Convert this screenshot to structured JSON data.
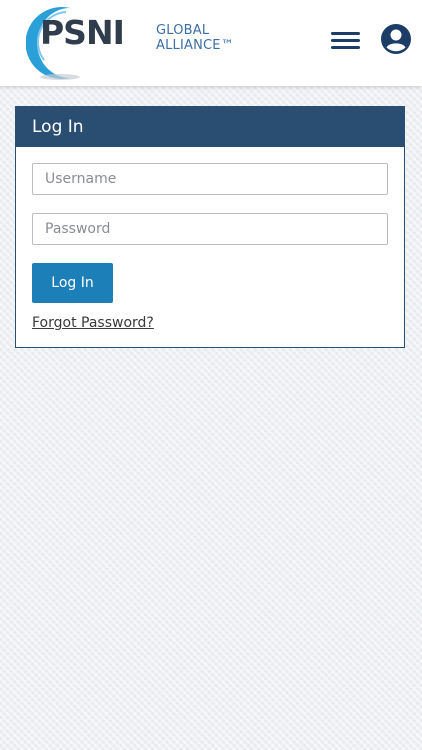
{
  "header": {
    "logo": {
      "brand": "PSNI",
      "line1": "GLOBAL",
      "line2": "ALLIANCE™"
    },
    "menu_icon": "hamburger-menu-icon",
    "user_icon": "user-account-icon"
  },
  "login": {
    "title": "Log In",
    "username_placeholder": "Username",
    "password_placeholder": "Password",
    "submit_label": "Log In",
    "forgot_label": "Forgot Password?"
  },
  "colors": {
    "header_bg": "#ffffff",
    "card_header_bg": "#2a4d72",
    "primary_button": "#1d7fb8",
    "icon_navy": "#1c3e66",
    "logo_blue": "#3b6ea5"
  }
}
